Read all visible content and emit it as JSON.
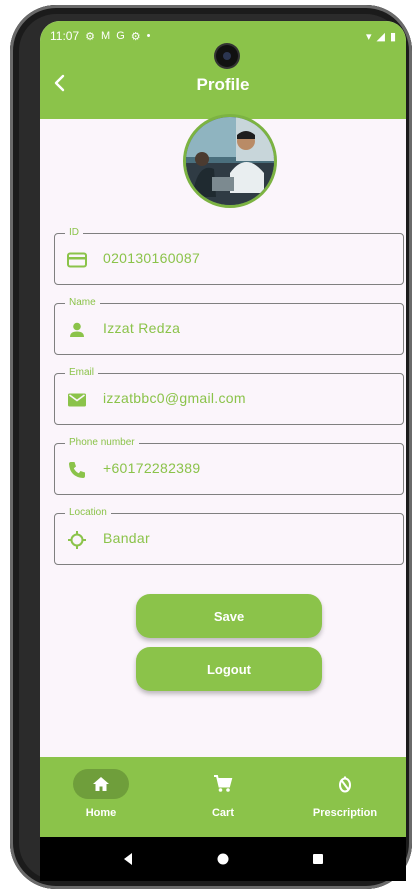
{
  "status_bar": {
    "time": "11:07",
    "icons": [
      "gear-icon",
      "gmail-icon",
      "google-icon",
      "settings-icon",
      "dot-icon"
    ],
    "right_icons": [
      "wifi-icon",
      "signal-icon",
      "battery-icon"
    ]
  },
  "app_bar": {
    "title": "Profile",
    "back_icon": "back-arrow-icon"
  },
  "fields": [
    {
      "label": "ID",
      "value": "020130160087",
      "icon": "card-icon"
    },
    {
      "label": "Name",
      "value": "Izzat Redza",
      "icon": "person-icon"
    },
    {
      "label": "Email",
      "value": "izzatbbc0@gmail.com",
      "icon": "mail-icon"
    },
    {
      "label": "Phone number",
      "value": "+60172282389",
      "icon": "phone-icon"
    },
    {
      "label": "Location",
      "value": "Bandar",
      "icon": "location-icon"
    }
  ],
  "buttons": {
    "save": "Save",
    "logout": "Logout"
  },
  "bottom_nav": [
    {
      "label": "Home",
      "icon": "home-icon",
      "active": true
    },
    {
      "label": "Cart",
      "icon": "cart-icon",
      "active": false
    },
    {
      "label": "Prescription",
      "icon": "prescription-icon",
      "active": false
    }
  ],
  "colors": {
    "primary": "#8bc34a",
    "active_nav": "#6f9e3b",
    "background": "#fbf5fb"
  }
}
